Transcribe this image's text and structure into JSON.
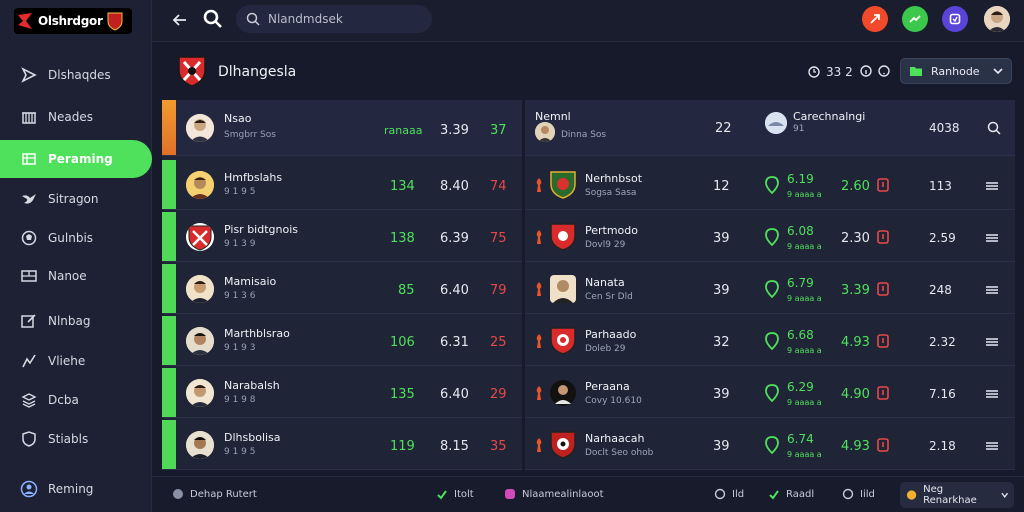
{
  "app": {
    "logo_text": "Olshrdgor"
  },
  "sidebar": {
    "items": [
      {
        "label": "Dlshaqdes",
        "icon": "flag-icon"
      },
      {
        "label": "Neades",
        "icon": "building-icon"
      },
      {
        "label": "Peraming",
        "icon": "table-icon",
        "active": true
      },
      {
        "label": "Sitragon",
        "icon": "bird-icon"
      },
      {
        "label": "Gulnbis",
        "icon": "ball-icon"
      },
      {
        "label": "Nanoe",
        "icon": "grid-icon"
      },
      {
        "label": "Nlnbag",
        "icon": "edit-icon"
      },
      {
        "label": "Vliehe",
        "icon": "chart-icon"
      },
      {
        "label": "Dcba",
        "icon": "stack-icon"
      },
      {
        "label": "Stiabls",
        "icon": "shield-icon"
      },
      {
        "label": "Reming",
        "icon": "globe-icon"
      }
    ]
  },
  "topbar": {
    "search_placeholder": "Nlandmdsek"
  },
  "header": {
    "title": "Dlhangesla",
    "stat1": "33 2",
    "stat2": "",
    "dropdown_label": "Ranhode"
  },
  "left_table": {
    "head": {
      "name": "Nsao",
      "sub": "Smgbrr Sos",
      "v1": "ranaaa",
      "v2": "3.39",
      "v3": "37"
    },
    "rows": [
      {
        "name": "Hmfbslahs",
        "sub": "9 1 9 5",
        "v1": "134",
        "v2": "8.40",
        "v3": "74"
      },
      {
        "name": "Pisr bidtgnois",
        "sub": "9 1 3 9",
        "v1": "138",
        "v2": "6.39",
        "v3": "75"
      },
      {
        "name": "Mamisaio",
        "sub": "9 1 3 6",
        "v1": "85",
        "v2": "6.40",
        "v3": "79"
      },
      {
        "name": "Marthblsrao",
        "sub": "9 1 9 3",
        "v1": "106",
        "v2": "6.31",
        "v3": "25"
      },
      {
        "name": "Narabalsh",
        "sub": "9 1 9 8",
        "v1": "135",
        "v2": "6.40",
        "v3": "29"
      },
      {
        "name": "Dlhsbolisa",
        "sub": "9 1 9 5",
        "v1": "119",
        "v2": "8.15",
        "v3": "35"
      }
    ]
  },
  "right_table": {
    "head": {
      "name": "Nemnl",
      "sub": "Dinna Sos",
      "n": "22",
      "name2": "Carechnalngi",
      "sub2": "91",
      "c": "4038"
    },
    "rows": [
      {
        "name": "Nerhnbsot",
        "sub": "Sogsa Sasa",
        "n": "12",
        "odd": "6.19",
        "oddsub": "9 aaaa a",
        "b": "2.60",
        "c": "113"
      },
      {
        "name": "Pertmodo",
        "sub": "Dovl9 29",
        "n": "39",
        "odd": "6.08",
        "oddsub": "9 aaaa a",
        "b": "2.30",
        "c": "2.59"
      },
      {
        "name": "Nanata",
        "sub": "Cen Sr Dld",
        "n": "39",
        "odd": "6.79",
        "oddsub": "9 aaaa a",
        "b": "3.39",
        "c": "248"
      },
      {
        "name": "Parhaado",
        "sub": "Doleb 29",
        "n": "32",
        "odd": "6.68",
        "oddsub": "9 aaaa a",
        "b": "4.93",
        "c": "2.32"
      },
      {
        "name": "Peraana",
        "sub": "Covy 10.610",
        "n": "39",
        "odd": "6.29",
        "oddsub": "9 aaaa a",
        "b": "4.90",
        "c": "7.16"
      },
      {
        "name": "Narhaacah",
        "sub": "Doclt Seo ohob",
        "n": "39",
        "odd": "6.74",
        "oddsub": "9 aaaa a",
        "b": "4.93",
        "c": "2.18"
      }
    ]
  },
  "footer": {
    "f1": "Dehap Rutert",
    "f2": "Itolt",
    "f3": "Nlaamealinlaoot",
    "f4": "Ild",
    "f5": "Raadl",
    "f6": "Iild",
    "pill": "Neg Renarkhae"
  },
  "colors": {
    "accent": "#4fe05c",
    "danger": "#e84848",
    "bg": "#161a2b"
  }
}
